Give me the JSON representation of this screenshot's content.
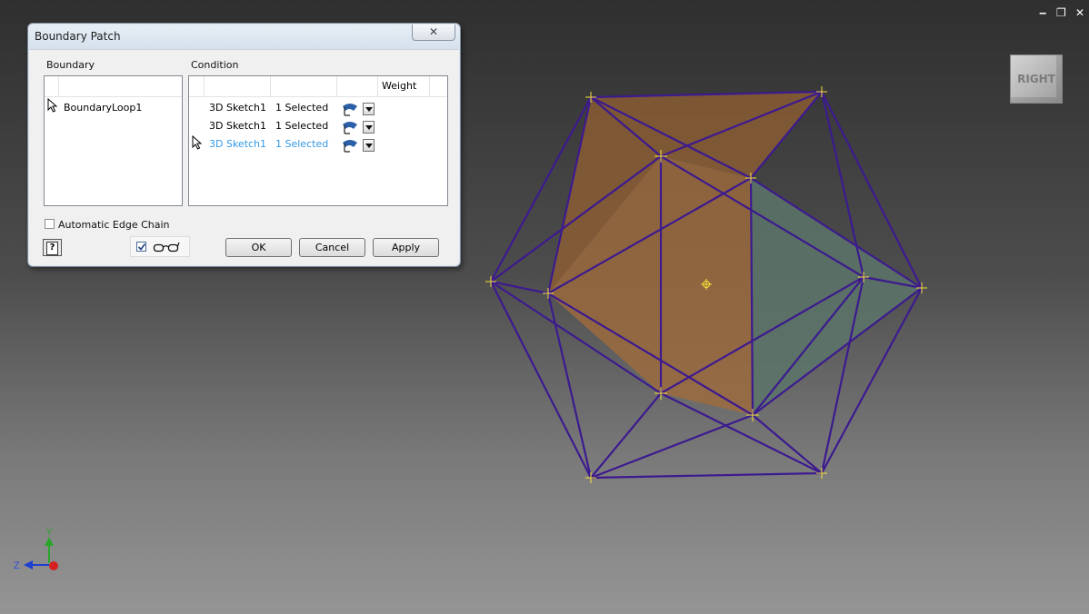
{
  "window": {
    "controls": [
      "‒",
      "❐",
      "✕"
    ]
  },
  "viewcube": {
    "face_label": "RIGHT"
  },
  "axis": {
    "y_label": "Y",
    "z_label": "Z"
  },
  "colors": {
    "wire": "#3c1a8f",
    "face_orange": "#a26a3a",
    "face_green": "#5f7a6a",
    "vertex": "#f5e13a",
    "selected_text": "#3399e8"
  },
  "dialog": {
    "title": "Boundary Patch",
    "close_symbol": "✕",
    "boundary_label": "Boundary",
    "condition_label": "Condition",
    "weight_header": "Weight",
    "boundary_items": [
      "BoundaryLoop1"
    ],
    "condition_rows": [
      {
        "sketch": "3D Sketch1",
        "selection": "1 Selected",
        "selected": false
      },
      {
        "sketch": "3D Sketch1",
        "selection": "1 Selected",
        "selected": false
      },
      {
        "sketch": "3D Sketch1",
        "selection": "1 Selected",
        "selected": true
      }
    ],
    "auto_edge_chain_label": "Automatic Edge Chain",
    "auto_edge_chain_checked": false,
    "preview_checked": true,
    "help_label": "?",
    "ok_label": "OK",
    "cancel_label": "Cancel",
    "apply_label": "Apply"
  }
}
